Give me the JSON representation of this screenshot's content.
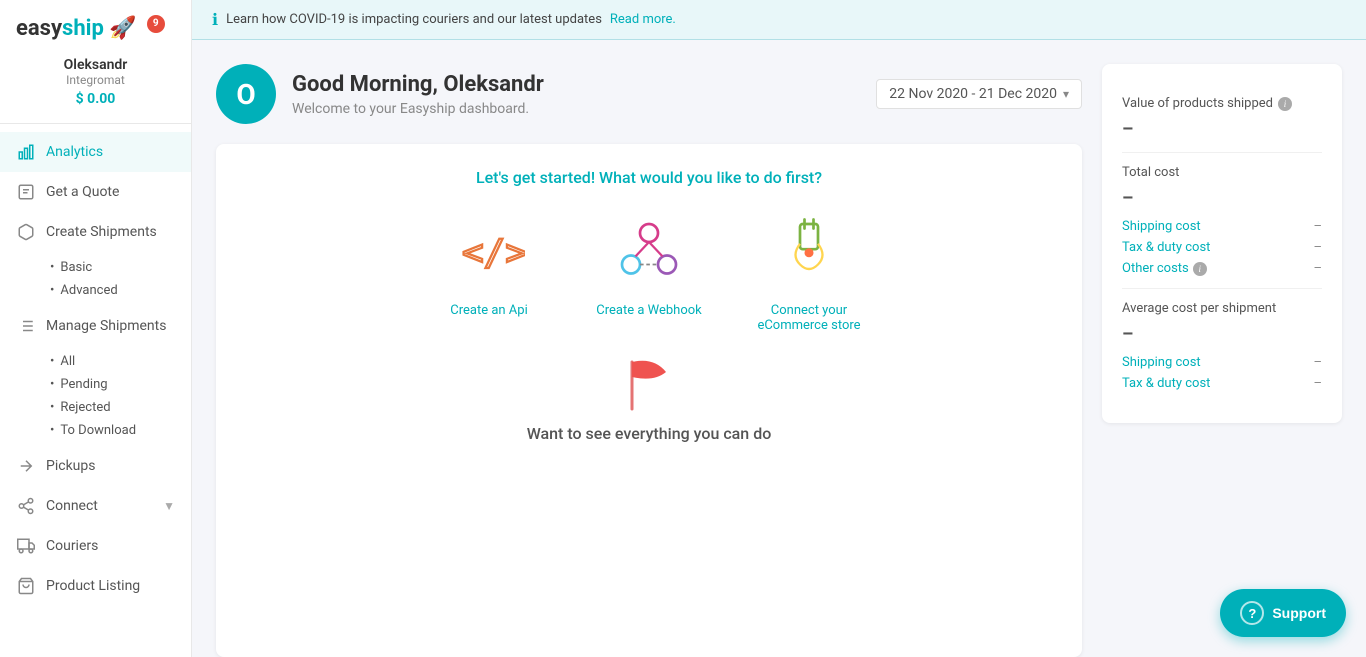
{
  "app": {
    "logo": "easyship",
    "notification_count": "9"
  },
  "sidebar": {
    "user": {
      "name": "Oleksandr",
      "company": "Integromat",
      "balance": "$ 0.00"
    },
    "nav_items": [
      {
        "id": "analytics",
        "label": "Analytics",
        "active": true,
        "icon": "chart-icon"
      },
      {
        "id": "get-a-quote",
        "label": "Get a Quote",
        "active": false,
        "icon": "quote-icon"
      },
      {
        "id": "create-shipments",
        "label": "Create Shipments",
        "active": false,
        "icon": "create-icon",
        "sub_items": [
          "Basic",
          "Advanced"
        ]
      },
      {
        "id": "manage-shipments",
        "label": "Manage Shipments",
        "active": false,
        "icon": "manage-icon",
        "sub_items": [
          "All",
          "Pending",
          "Rejected",
          "To Download"
        ]
      },
      {
        "id": "pickups",
        "label": "Pickups",
        "active": false,
        "icon": "pickup-icon"
      },
      {
        "id": "connect",
        "label": "Connect",
        "active": false,
        "icon": "connect-icon",
        "has_arrow": true
      },
      {
        "id": "couriers",
        "label": "Couriers",
        "active": false,
        "icon": "couriers-icon"
      },
      {
        "id": "product-listing",
        "label": "Product Listing",
        "active": false,
        "icon": "product-icon"
      }
    ]
  },
  "banner": {
    "text": "Learn how COVID-19 is impacting couriers and our latest updates",
    "link_text": "Read more."
  },
  "greeting": {
    "avatar_letter": "O",
    "title": "Good Morning, Oleksandr",
    "subtitle": "Welcome to your Easyship dashboard."
  },
  "date_range": {
    "text": "22 Nov 2020  -  21 Dec 2020"
  },
  "main_card": {
    "get_started_text": "Let's get started! What would you like to do first?",
    "actions": [
      {
        "id": "create-api",
        "label": "Create an Api",
        "icon_type": "api"
      },
      {
        "id": "create-webhook",
        "label": "Create a Webhook",
        "icon_type": "webhook"
      },
      {
        "id": "connect-ecommerce",
        "label": "Connect your eCommerce store",
        "icon_type": "ecommerce"
      }
    ],
    "bottom_text": "Want to see everything you can do"
  },
  "right_panel": {
    "sections": [
      {
        "id": "value-shipped",
        "label": "Value of products shipped",
        "has_info": true,
        "value": "–",
        "sub_items": []
      },
      {
        "id": "total-cost",
        "label": "Total cost",
        "has_info": false,
        "value": "–",
        "sub_items": [
          {
            "label": "Shipping cost",
            "value": "–"
          },
          {
            "label": "Tax & duty cost",
            "value": "–"
          },
          {
            "label": "Other costs",
            "has_info": true,
            "value": "–"
          }
        ]
      },
      {
        "id": "avg-cost",
        "label": "Average cost per shipment",
        "has_info": false,
        "value": "–",
        "sub_items": [
          {
            "label": "Shipping cost",
            "value": "–"
          },
          {
            "label": "Tax & duty cost",
            "value": "–"
          }
        ]
      }
    ]
  },
  "support": {
    "button_label": "Support"
  }
}
